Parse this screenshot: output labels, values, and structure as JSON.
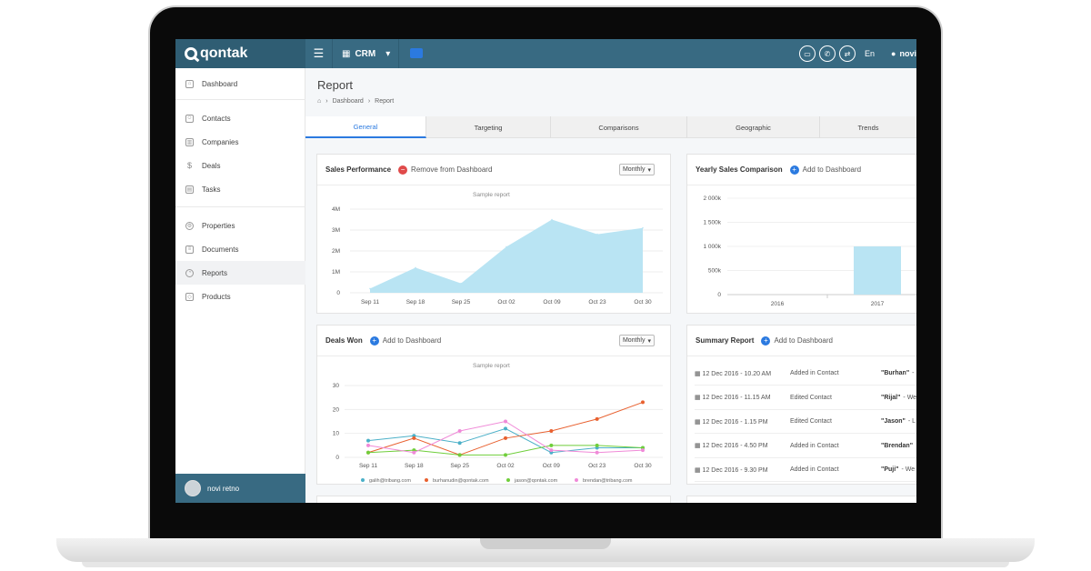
{
  "app": {
    "brand": "qontak",
    "module": "CRM",
    "lang": "En",
    "user": "novi"
  },
  "sidebar": {
    "items": [
      {
        "label": "Dashboard"
      },
      {
        "label": "Contacts"
      },
      {
        "label": "Companies"
      },
      {
        "label": "Deals"
      },
      {
        "label": "Tasks"
      },
      {
        "label": "Properties"
      },
      {
        "label": "Documents"
      },
      {
        "label": "Reports"
      },
      {
        "label": "Products"
      }
    ],
    "user_name": "novi retno"
  },
  "page": {
    "title": "Report",
    "breadcrumb": [
      "Dashboard",
      "Report"
    ],
    "tabs": [
      "General",
      "Targeting",
      "Comparisons",
      "Geographic",
      "Trends"
    ]
  },
  "sales_panel": {
    "title": "Sales Performance",
    "action": "Remove from Dashboard",
    "period": "Monthly",
    "sample": "Sample report"
  },
  "yearly_panel": {
    "title": "Yearly Sales Comparison",
    "action": "Add to Dashboard"
  },
  "deals_panel": {
    "title": "Deals Won",
    "action": "Add to Dashboard",
    "period": "Monthly",
    "sample": "Sample report"
  },
  "summary_panel": {
    "title": "Summary Report",
    "action": "Add to Dashboard",
    "rows": [
      {
        "date": "12 Dec 2016 - 10.20 AM",
        "action": "Added in Contact",
        "who": "\"Burhan\"",
        "tail": "-"
      },
      {
        "date": "12 Dec 2016 - 11.15 AM",
        "action": "Edited Contact",
        "who": "\"Rijal\"",
        "tail": "- We"
      },
      {
        "date": "12 Dec 2016 - 1.15 PM",
        "action": "Edited Contact",
        "who": "\"Jason\"",
        "tail": "- L"
      },
      {
        "date": "12 Dec 2016 - 4.50 PM",
        "action": "Added in Contact",
        "who": "\"Brendan\"",
        "tail": ""
      },
      {
        "date": "12 Dec 2016 - 9.30 PM",
        "action": "Added in Contact",
        "who": "\"Puji\"",
        "tail": "- We"
      }
    ]
  },
  "chart_data": [
    {
      "type": "area",
      "title": "Sample report",
      "categories": [
        "Sep 11",
        "Sep 18",
        "Sep 25",
        "Oct 02",
        "Oct 09",
        "Oct 23",
        "Oct 30"
      ],
      "y_ticks": [
        "4M",
        "3M",
        "2M",
        "1M",
        "0"
      ],
      "ylim": [
        0,
        4000000
      ],
      "values": [
        200000,
        1200000,
        450000,
        2200000,
        3500000,
        2800000,
        3100000
      ],
      "color": "#b9e4f3"
    },
    {
      "type": "bar",
      "categories": [
        "2016",
        "2017"
      ],
      "y_ticks": [
        "2 000k",
        "1 500k",
        "1 000k",
        "500k",
        "0"
      ],
      "ylim": [
        0,
        2000000
      ],
      "values": [
        0,
        1000000
      ],
      "color": "#b9e4f3"
    },
    {
      "type": "line",
      "title": "Sample report",
      "categories": [
        "Sep 11",
        "Sep 18",
        "Sep 25",
        "Oct 02",
        "Oct 09",
        "Oct 23",
        "Oct 30"
      ],
      "y_ticks": [
        "30",
        "20",
        "10",
        "0"
      ],
      "ylim": [
        0,
        30
      ],
      "series": [
        {
          "name": "galih@tribang.com",
          "color": "#4bb0c8",
          "values": [
            7,
            9,
            6,
            12,
            2,
            4,
            4
          ]
        },
        {
          "name": "burhanudin@qontak.com",
          "color": "#e8602f",
          "values": [
            2,
            8,
            1,
            8,
            11,
            16,
            23
          ]
        },
        {
          "name": "jason@qontak.com",
          "color": "#6fce3a",
          "values": [
            2,
            3,
            1,
            1,
            5,
            5,
            4
          ]
        },
        {
          "name": "brendan@tribang.com",
          "color": "#f08ad8",
          "values": [
            5,
            2,
            11,
            15,
            3,
            2,
            3
          ]
        }
      ]
    }
  ]
}
